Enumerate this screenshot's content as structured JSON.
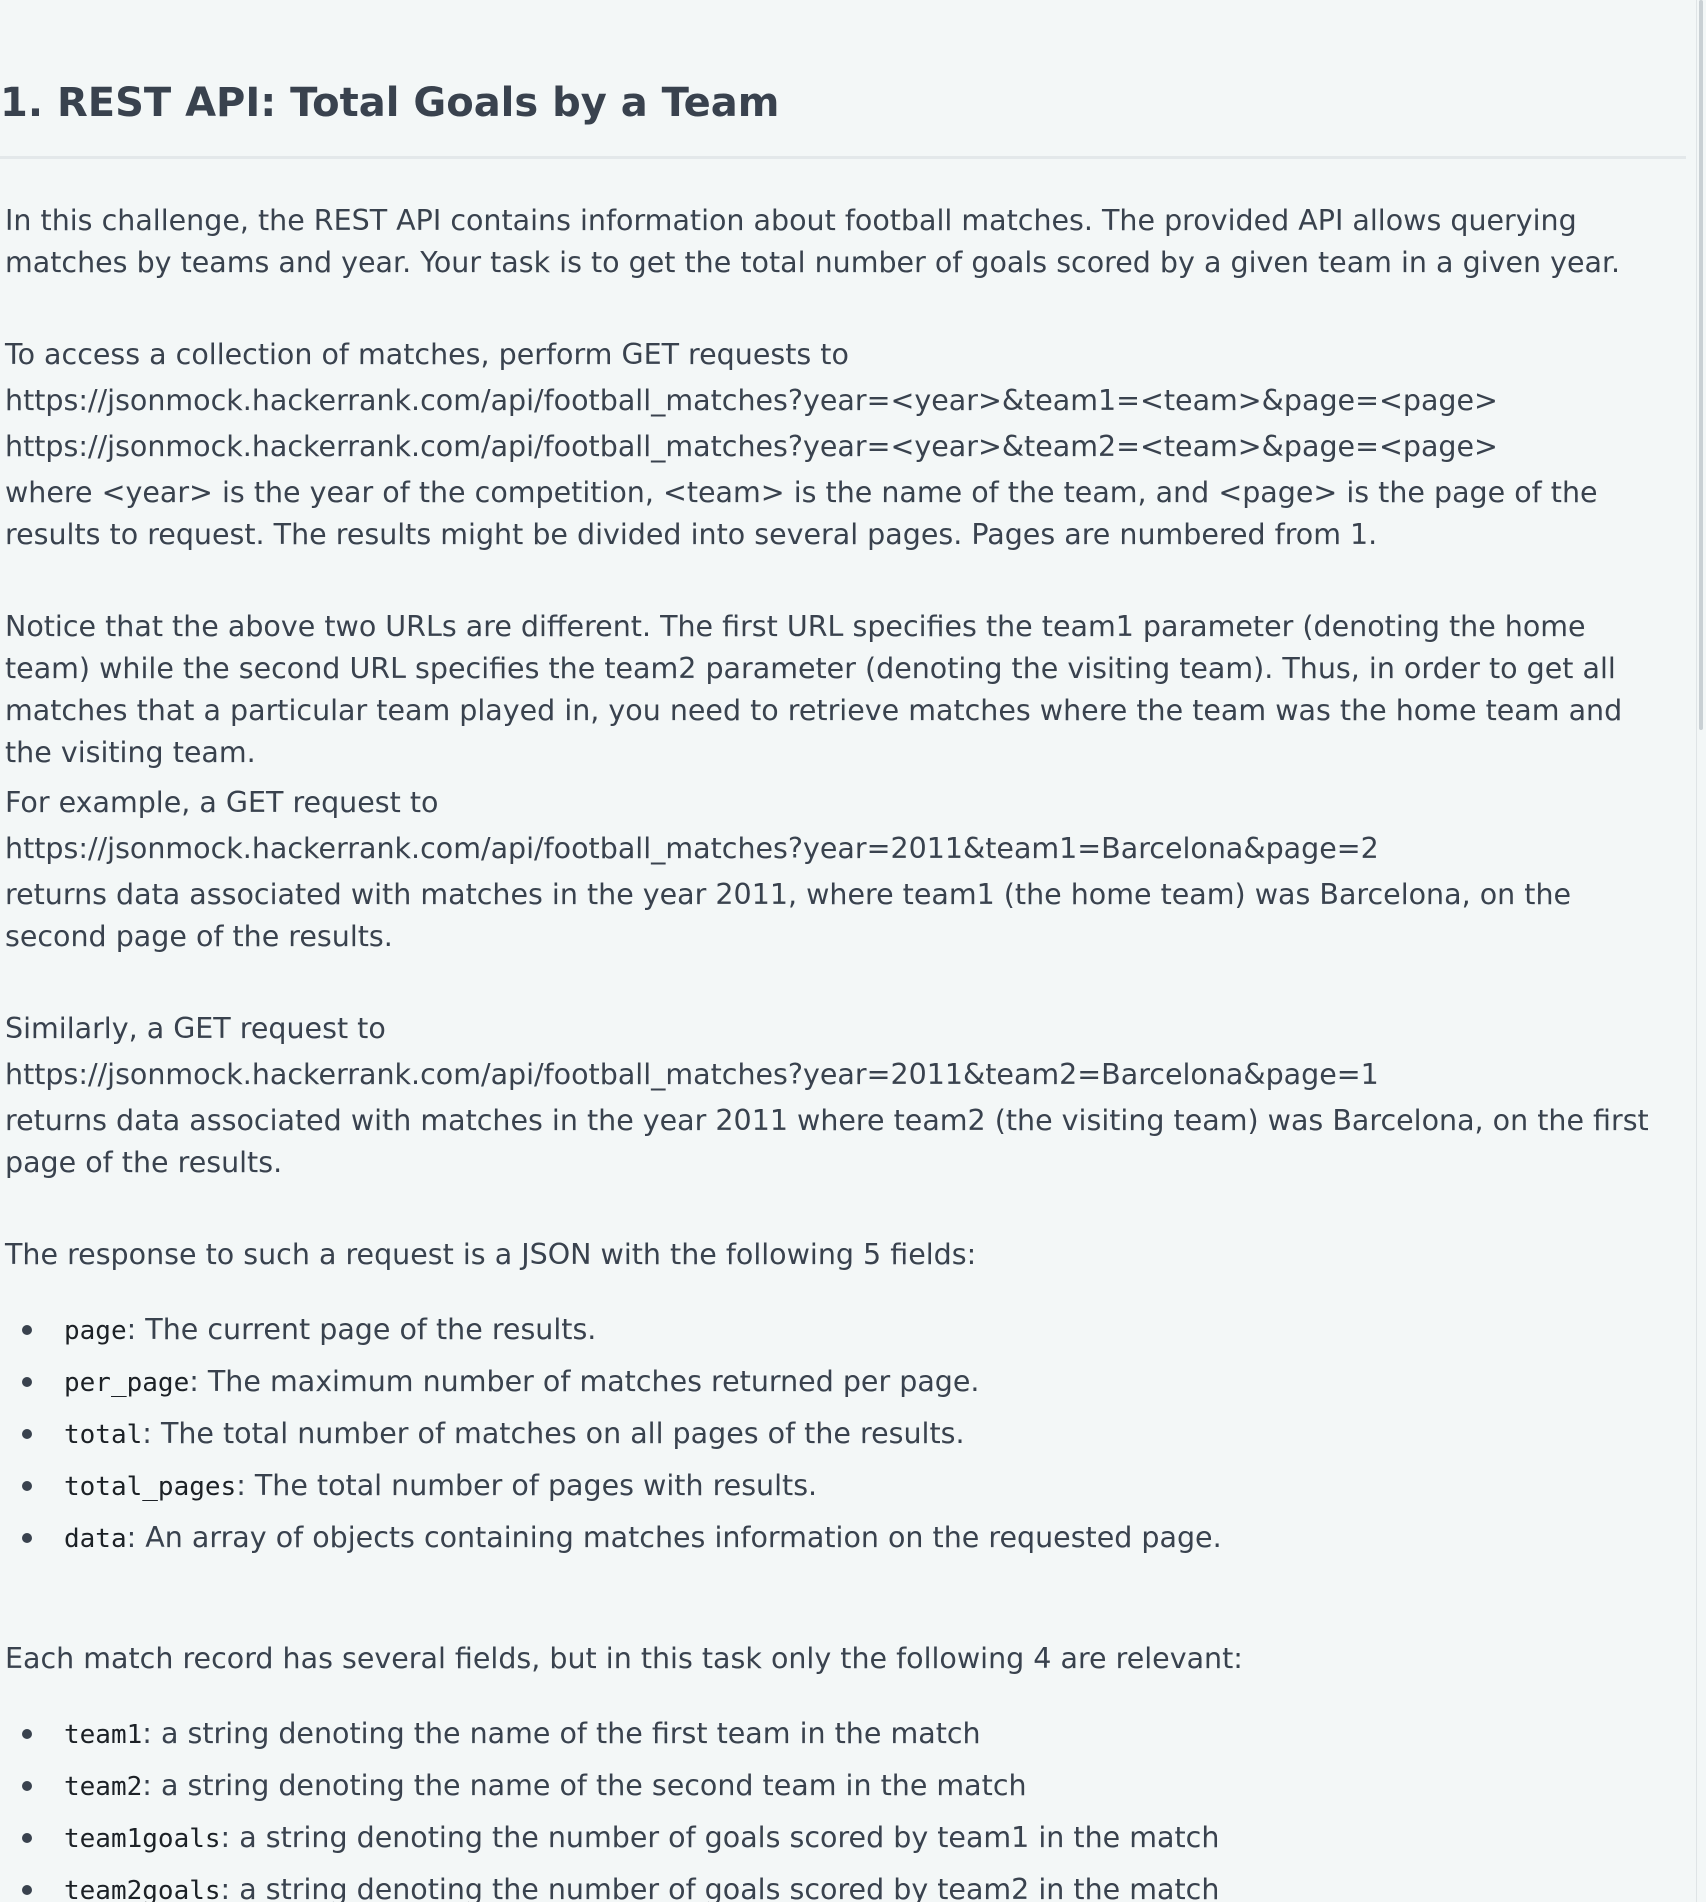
{
  "title": "1. REST API: Total Goals by a Team",
  "intro": "In this challenge, the REST API contains information about football matches. The provided API allows querying matches by teams and year. Your task is to get the total number of goals scored by a given team in a given year.",
  "access": {
    "lead": "To access a collection of matches, perform GET requests to",
    "url1": "https://jsonmock.hackerrank.com/api/football_matches?year=<year>&team1=<team>&page=<page>",
    "url2": "https://jsonmock.hackerrank.com/api/football_matches?year=<year>&team2=<team>&page=<page>",
    "explanation": "where <year> is the year of the competition, <team> is the name of the team, and <page> is the page of the results to request. The results might be divided into several pages. Pages are numbered from 1."
  },
  "notice": "Notice that the above two URLs are different. The first URL specifies the team1 parameter (denoting the home team) while the second URL specifies the team2 parameter (denoting the visiting team). Thus, in order to get all matches that a particular team played in, you need to retrieve matches where the team was the home team and the visiting team.",
  "example1": {
    "lead": "For example, a GET request to",
    "url": "https://jsonmock.hackerrank.com/api/football_matches?year=2011&team1=Barcelona&page=2",
    "result": "returns data associated with matches in the year 2011, where team1 (the home team) was Barcelona, on the second page of the results."
  },
  "example2": {
    "lead": "Similarly, a GET request to",
    "url": "https://jsonmock.hackerrank.com/api/football_matches?year=2011&team2=Barcelona&page=1",
    "result": "returns data associated with matches in the year 2011 where team2 (the visiting team) was Barcelona, on the first page of the results."
  },
  "response": {
    "lead": "The response to such a request is a JSON with the following 5 fields:",
    "fields": [
      {
        "name": "page",
        "desc": ": The current page of the results."
      },
      {
        "name": "per_page",
        "desc": ": The maximum number of matches returned per page."
      },
      {
        "name": "total",
        "desc": ": The total number of matches on all pages of the results."
      },
      {
        "name": "total_pages",
        "desc": ": The total number of pages with results."
      },
      {
        "name": "data",
        "desc": ": An array of objects containing matches information on the requested page."
      }
    ]
  },
  "record": {
    "lead": "Each match record has several fields, but in this task only the following 4 are relevant:",
    "fields": [
      {
        "name": "team1",
        "desc": ": a string denoting the name of the first team in the match"
      },
      {
        "name": "team2",
        "desc": ": a string denoting the name of the second team in the match"
      },
      {
        "name": "team1goals",
        "desc": ": a string denoting the number of goals scored by team1 in the match"
      },
      {
        "name": "team2goals",
        "desc": ": a string denoting the number of goals scored by team2 in the match"
      }
    ]
  }
}
